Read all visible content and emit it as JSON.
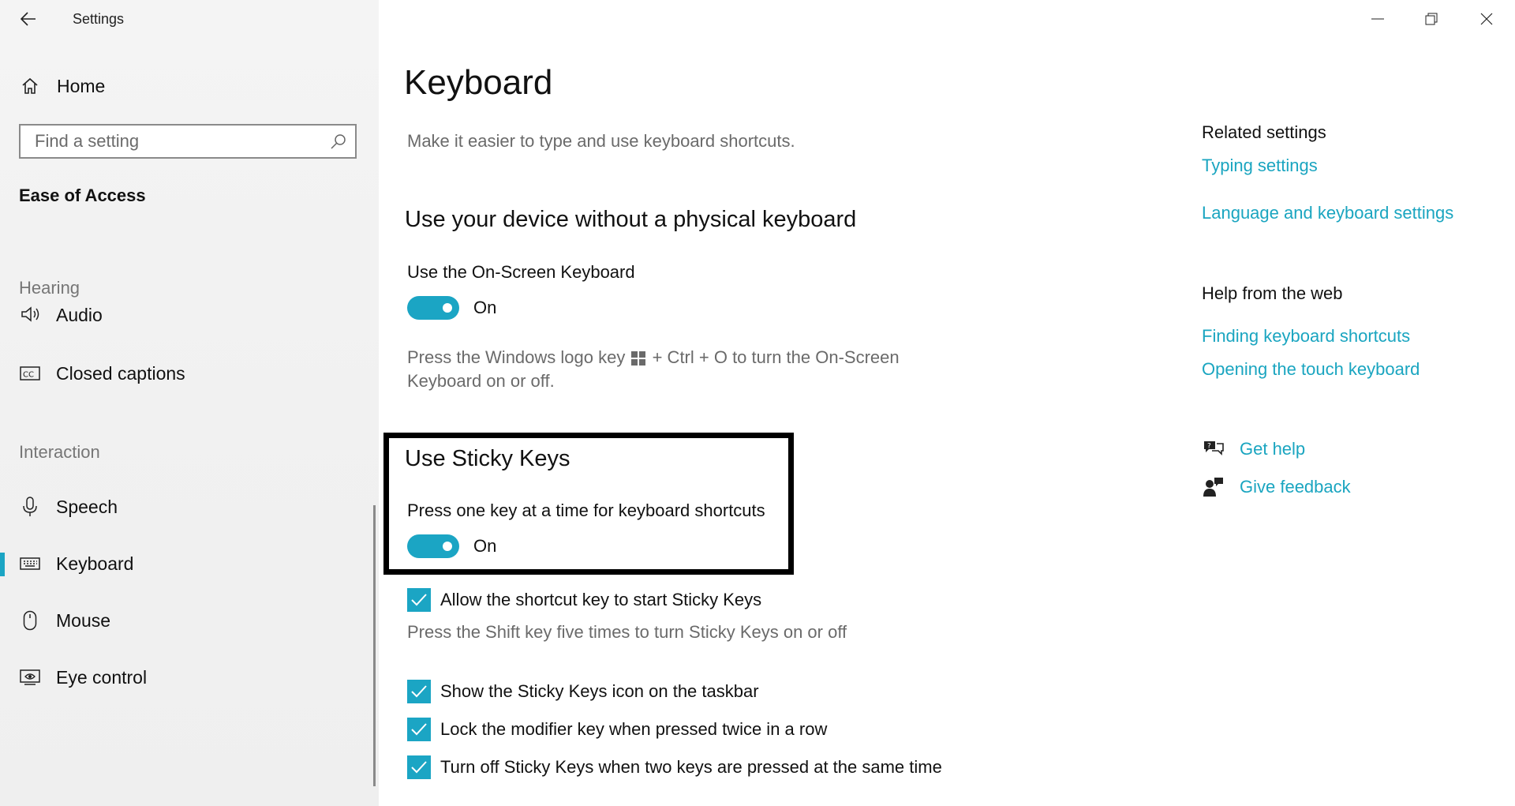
{
  "window": {
    "title": "Settings",
    "controls": {
      "minimize": "minimize-icon",
      "maximize": "restore-icon",
      "close": "close-icon"
    }
  },
  "sidebar": {
    "home_label": "Home",
    "search_placeholder": "Find a setting",
    "section_title": "Ease of Access",
    "groups": {
      "hearing": "Hearing",
      "interaction": "Interaction"
    },
    "items": {
      "audio": "Audio",
      "captions": "Closed captions",
      "speech": "Speech",
      "keyboard": "Keyboard",
      "mouse": "Mouse",
      "eye_control": "Eye control"
    },
    "selected": "Keyboard"
  },
  "main": {
    "title": "Keyboard",
    "description": "Make it easier to type and use keyboard shortcuts.",
    "osk_section": {
      "heading": "Use your device without a physical keyboard",
      "label": "Use the On-Screen Keyboard",
      "toggle_state": "On",
      "hint_before": "Press the Windows logo key",
      "hint_after": "+ Ctrl + O to turn the On-Screen Keyboard on or off."
    },
    "sticky_section": {
      "heading": "Use Sticky Keys",
      "label": "Press one key at a time for keyboard shortcuts",
      "toggle_state": "On",
      "checkboxes": [
        {
          "label": "Allow the shortcut key to start Sticky Keys",
          "checked": true
        },
        {
          "label": "Show the Sticky Keys icon on the taskbar",
          "checked": true
        },
        {
          "label": "Lock the modifier key when pressed twice in a row",
          "checked": true
        },
        {
          "label": "Turn off Sticky Keys when two keys are pressed at the same time",
          "checked": true
        }
      ],
      "shortcut_hint": "Press the Shift key five times to turn Sticky Keys on or off"
    }
  },
  "right_panel": {
    "related_heading": "Related settings",
    "related_links": [
      "Typing settings",
      "Language and keyboard settings"
    ],
    "help_heading": "Help from the web",
    "help_links": [
      "Finding keyboard shortcuts",
      "Opening the touch keyboard"
    ],
    "actions": {
      "get_help": "Get help",
      "give_feedback": "Give feedback"
    }
  },
  "colors": {
    "accent": "#1ba5c4",
    "link": "#1aa5c0",
    "muted_text": "#6a6a6a",
    "sidebar_bg": "#f2f2f2"
  }
}
